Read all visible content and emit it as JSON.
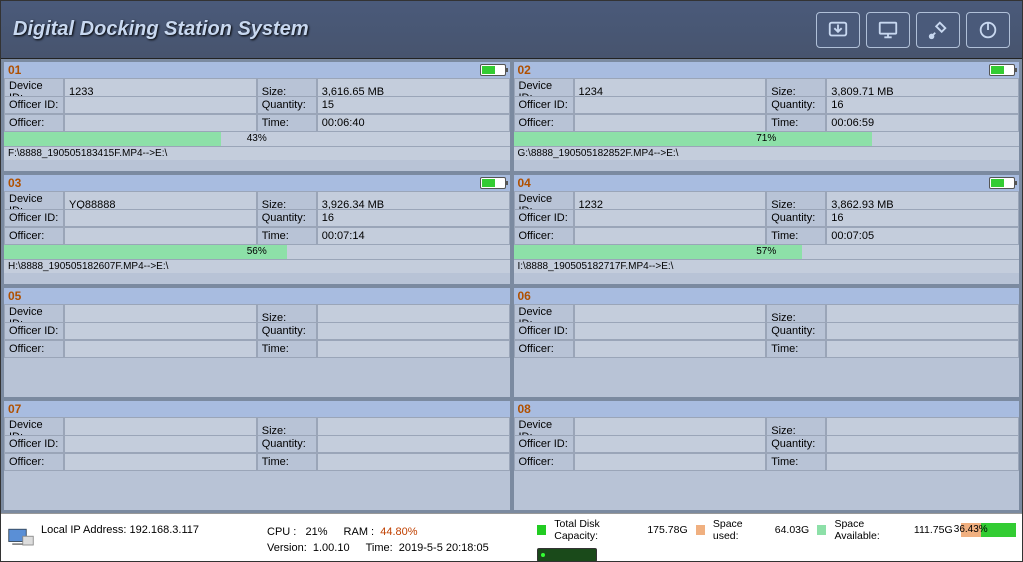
{
  "title": "Digital Docking Station System",
  "toolbar_icons": [
    "download-icon",
    "monitor-icon",
    "tools-icon",
    "power-icon"
  ],
  "labels": {
    "device_id": "Device ID:",
    "officer_id": "Officer ID:",
    "officer": "Officer:",
    "size": "Size:",
    "quantity": "Quantity:",
    "time": "Time:"
  },
  "slots": [
    {
      "num": "01",
      "active": true,
      "battery": 60,
      "device_id": "1233",
      "officer_id": "",
      "officer": "",
      "size": "3,616.65 MB",
      "quantity": "15",
      "time": "00:06:40",
      "progress": 43,
      "file": "F:\\8888_190505183415F.MP4-->E:\\"
    },
    {
      "num": "02",
      "active": true,
      "battery": 60,
      "device_id": "1234",
      "officer_id": "",
      "officer": "",
      "size": "3,809.71 MB",
      "quantity": "16",
      "time": "00:06:59",
      "progress": 71,
      "file": "G:\\8888_190505182852F.MP4-->E:\\"
    },
    {
      "num": "03",
      "active": true,
      "battery": 60,
      "device_id": "YQ88888",
      "officer_id": "",
      "officer": "",
      "size": "3,926.34 MB",
      "quantity": "16",
      "time": "00:07:14",
      "progress": 56,
      "file": "H:\\8888_190505182607F.MP4-->E:\\"
    },
    {
      "num": "04",
      "active": true,
      "battery": 60,
      "device_id": "1232",
      "officer_id": "",
      "officer": "",
      "size": "3,862.93 MB",
      "quantity": "16",
      "time": "00:07:05",
      "progress": 57,
      "file": "I:\\8888_190505182717F.MP4-->E:\\"
    },
    {
      "num": "05",
      "active": false
    },
    {
      "num": "06",
      "active": false
    },
    {
      "num": "07",
      "active": false
    },
    {
      "num": "08",
      "active": false
    }
  ],
  "status": {
    "ip_label": "Local IP Address:",
    "ip": "192.168.3.117",
    "cpu_label": "CPU :",
    "cpu": "21%",
    "ram_label": "RAM :",
    "ram": "44.80%",
    "version_label": "Version:",
    "version": "1.00.10",
    "time_label": "Time:",
    "time": "2019-5-5 20:18:05",
    "disk_total_label": "Total Disk Capacity:",
    "disk_total": "175.78G",
    "disk_used_label": "Space used:",
    "disk_used": "64.03G",
    "disk_avail_label": "Space Available:",
    "disk_avail": "111.75G",
    "disk_pct": "36.43%",
    "disk_pct_num": 36.43
  }
}
